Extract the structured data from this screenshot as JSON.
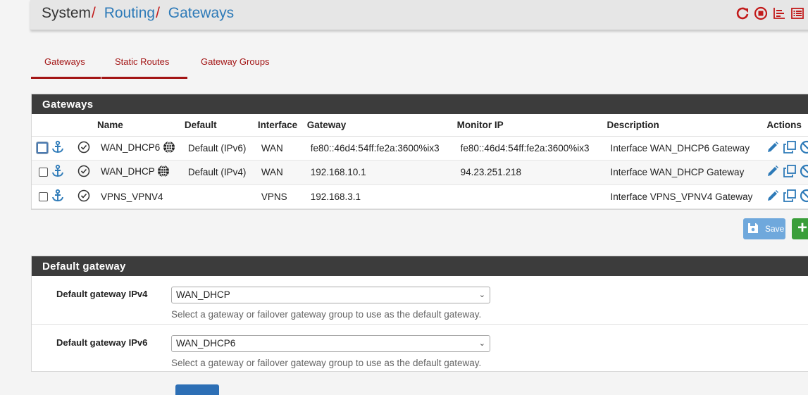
{
  "breadcrumb": {
    "system": "System",
    "routing": "Routing",
    "gateways": "Gateways",
    "sep": "/"
  },
  "header_icons": [
    "reload-icon",
    "stop-icon",
    "chart-icon",
    "list-icon"
  ],
  "tabs": [
    {
      "label": "Gateways",
      "active": true
    },
    {
      "label": "Static Routes",
      "active": false
    },
    {
      "label": "Gateway Groups",
      "active": false
    }
  ],
  "gateways_panel": {
    "title": "Gateways",
    "columns": [
      "Name",
      "Default",
      "Interface",
      "Gateway",
      "Monitor IP",
      "Description",
      "Actions"
    ],
    "rows": [
      {
        "name": "WAN_DHCP6",
        "default": "Default (IPv6)",
        "interface": "WAN",
        "gateway": "fe80::46d4:54ff:fe2a:3600%ix3",
        "monitor_ip": "fe80::46d4:54ff:fe2a:3600%ix3",
        "description": "Interface WAN_DHCP6 Gateway"
      },
      {
        "name": "WAN_DHCP",
        "default": "Default (IPv4)",
        "interface": "WAN",
        "gateway": "192.168.10.1",
        "monitor_ip": "94.23.251.218",
        "description": "Interface WAN_DHCP Gateway"
      },
      {
        "name": "VPNS_VPNV4",
        "default": "",
        "interface": "VPNS",
        "gateway": "192.168.3.1",
        "monitor_ip": "",
        "description": "Interface VPNS_VPNV4 Gateway"
      }
    ],
    "save_label": "Save",
    "add_label": "+"
  },
  "default_gateway_panel": {
    "title": "Default gateway",
    "ipv4": {
      "label": "Default gateway IPv4",
      "value": "WAN_DHCP",
      "help": "Select a gateway or failover gateway group to use as the default gateway."
    },
    "ipv6": {
      "label": "Default gateway IPv6",
      "value": "WAN_DHCP6",
      "help": "Select a gateway or failover gateway group to use as the default gateway."
    }
  },
  "colors": {
    "accent_red": "#a31515",
    "link_blue": "#2d7ab8",
    "panel_header": "#3c3c3c",
    "save_blue": "#6fa8dc",
    "add_green": "#3a9e3a"
  }
}
